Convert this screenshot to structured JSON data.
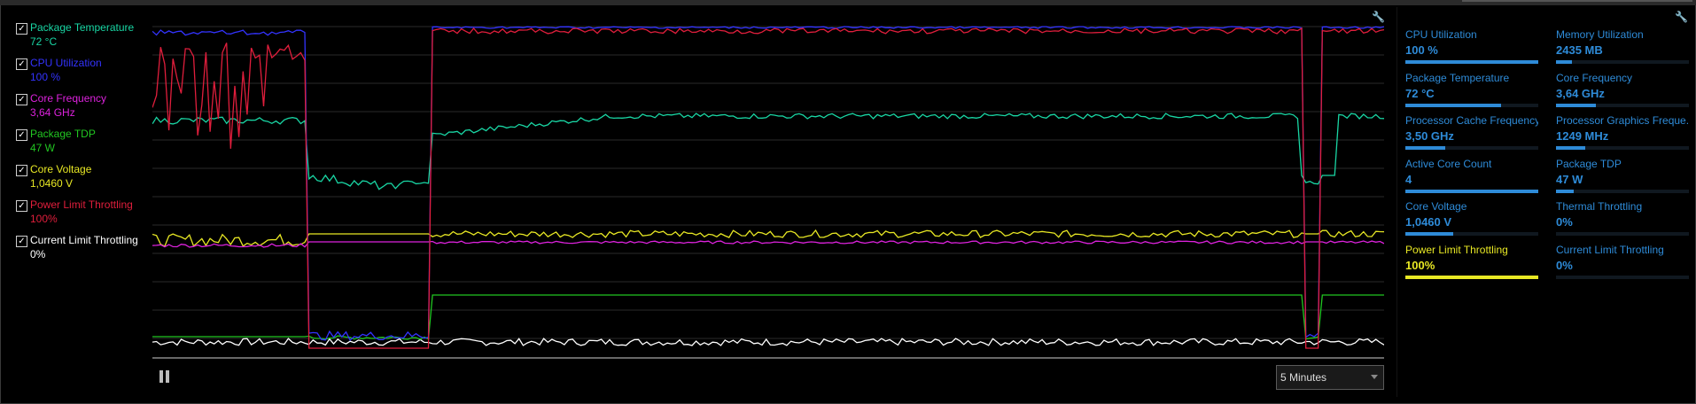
{
  "legend": [
    {
      "name": "Package Temperature",
      "value": "72 °C",
      "color": "#19d6a4",
      "checked": true
    },
    {
      "name": "CPU Utilization",
      "value": "100 %",
      "color": "#3333ff",
      "checked": true
    },
    {
      "name": "Core Frequency",
      "value": "3,64 GHz",
      "color": "#dd22dd",
      "checked": true
    },
    {
      "name": "Package TDP",
      "value": "47 W",
      "color": "#21c621",
      "checked": true
    },
    {
      "name": "Core Voltage",
      "value": "1,0460 V",
      "color": "#e8e824",
      "checked": true
    },
    {
      "name": "Power Limit Throttling",
      "value": "100%",
      "color": "#e01e3c",
      "checked": true
    },
    {
      "name": "Current Limit Throttling",
      "value": "0%",
      "color": "#ffffff",
      "checked": true
    }
  ],
  "graph": {
    "background": "#000000",
    "grid_color": "#2a2a2a",
    "time_range": "5 Minutes",
    "time_options": [
      "5 Minutes"
    ],
    "pause_icon": "pause-icon",
    "settings_icon": "wrench-icon"
  },
  "stats": [
    {
      "label": "CPU Utilization",
      "value": "100 %",
      "level": 1.0,
      "highlight": false
    },
    {
      "label": "Memory Utilization",
      "value": "2435  MB",
      "level": 0.12,
      "highlight": false
    },
    {
      "label": "Package Temperature",
      "value": "72 °C",
      "level": 0.72,
      "highlight": false
    },
    {
      "label": "Core Frequency",
      "value": "3,64 GHz",
      "level": 0.3,
      "highlight": false
    },
    {
      "label": "Processor Cache Frequency",
      "value": "3,50 GHz",
      "level": 0.3,
      "highlight": false
    },
    {
      "label": "Processor Graphics Freque...",
      "value": "1249 MHz",
      "level": 0.22,
      "highlight": false
    },
    {
      "label": "Active Core Count",
      "value": "4",
      "level": 1.0,
      "highlight": false
    },
    {
      "label": "Package TDP",
      "value": "47 W",
      "level": 0.13,
      "highlight": false
    },
    {
      "label": "Core Voltage",
      "value": "1,0460 V",
      "level": 0.36,
      "highlight": false
    },
    {
      "label": "Thermal Throttling",
      "value": "0%",
      "level": 0.0,
      "highlight": false
    },
    {
      "label": "Power Limit Throttling",
      "value": "100%",
      "level": 1.0,
      "highlight": true
    },
    {
      "label": "Current Limit Throttling",
      "value": "0%",
      "level": 0.0,
      "highlight": false
    }
  ],
  "colors": {
    "accent": "#2e8bd8",
    "highlight": "#e8e824"
  }
}
